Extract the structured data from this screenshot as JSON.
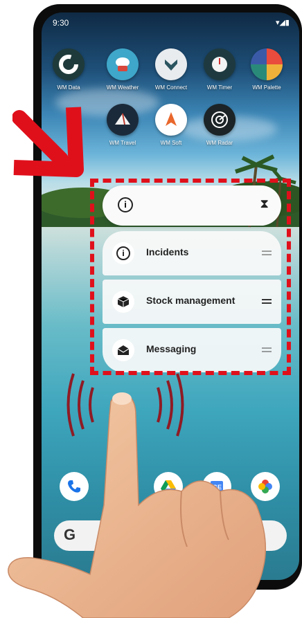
{
  "status_bar": {
    "time": "9:30"
  },
  "apps_row1": [
    {
      "label": "WM Data",
      "icon": "wm-data-icon",
      "color": "#1f3a3a"
    },
    {
      "label": "WM Weather",
      "icon": "wm-weather-icon",
      "color": "#3fa7c9"
    },
    {
      "label": "WM Connect",
      "icon": "wm-connect-icon",
      "color": "#e8ecef"
    },
    {
      "label": "WM Timer",
      "icon": "wm-timer-icon",
      "color": "#1e3a40"
    },
    {
      "label": "WM Palette",
      "icon": "wm-palette-icon",
      "color": "#f0b13a"
    }
  ],
  "apps_row2": [
    {
      "label": "WM Travel",
      "icon": "wm-travel-icon",
      "color": "#1b2a3a"
    },
    {
      "label": "WM Soft",
      "icon": "wm-soft-icon",
      "color": "#ffffff"
    },
    {
      "label": "WM Radar",
      "icon": "wm-radar-icon",
      "color": "#1c2427"
    }
  ],
  "shortcuts": [
    {
      "label": "Incidents",
      "icon": "info-icon"
    },
    {
      "label": "Stock management",
      "icon": "box-icon"
    },
    {
      "label": "Messaging",
      "icon": "envelope-icon"
    }
  ],
  "dock": [
    "phone-icon",
    "messages-icon",
    "drive-icon",
    "news-icon",
    "photos-icon"
  ],
  "search": {
    "logo": "G"
  },
  "colors": {
    "highlight": "#e0101b",
    "arrow": "#e0101b"
  }
}
